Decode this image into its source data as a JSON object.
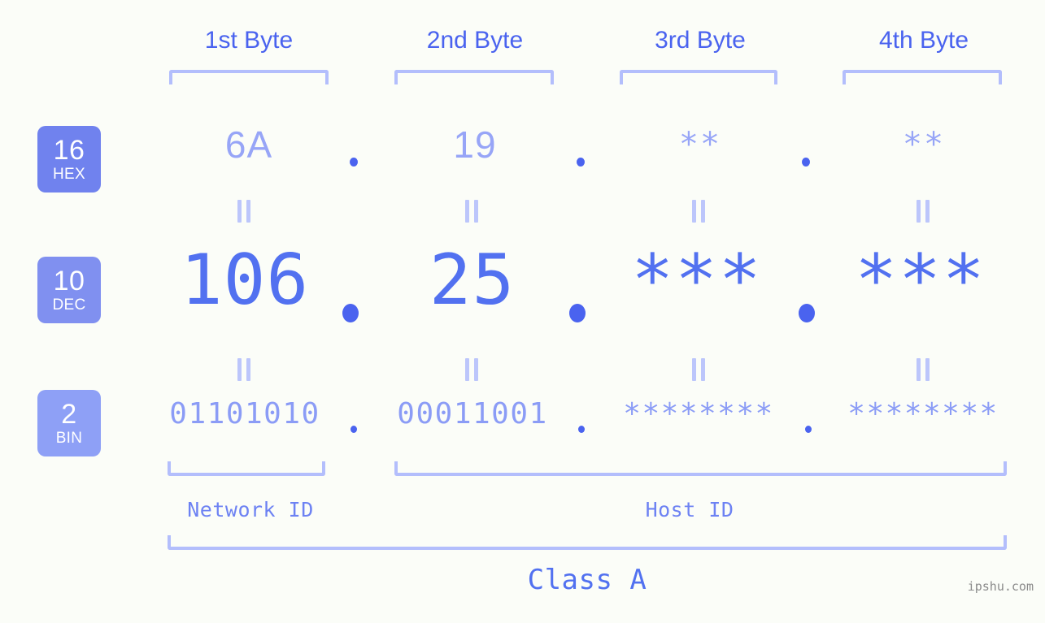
{
  "page": {
    "background": "#fbfdf8",
    "accent": "#5271f0",
    "accent_light": "#97a5f7",
    "bracket_color": "#b3befc",
    "watermark": "ipshu.com"
  },
  "byte_headers": [
    {
      "label": "1st Byte"
    },
    {
      "label": "2nd Byte"
    },
    {
      "label": "3rd Byte"
    },
    {
      "label": "4th Byte"
    }
  ],
  "bases": [
    {
      "number": "16",
      "name": "HEX",
      "color": "#7082ee"
    },
    {
      "number": "10",
      "name": "DEC",
      "color": "#8090f0"
    },
    {
      "number": "2",
      "name": "BIN",
      "color": "#8ea0f6"
    }
  ],
  "rows": {
    "hex": {
      "base_number": "16",
      "base_name": "HEX",
      "values": [
        "6A",
        "19",
        "**",
        "**"
      ],
      "separator": "."
    },
    "dec": {
      "base_number": "10",
      "base_name": "DEC",
      "values": [
        "106",
        "25",
        "***",
        "***"
      ],
      "separator": "."
    },
    "bin": {
      "base_number": "2",
      "base_name": "BIN",
      "values": [
        "01101010",
        "00011001",
        "********",
        "********"
      ],
      "separator": "."
    }
  },
  "equals_glyph": "||",
  "sections": {
    "network_id": "Network ID",
    "host_id": "Host ID",
    "class": "Class A"
  },
  "address": {
    "hex": "6A.19.**.**",
    "dec": "106.25.***.***",
    "bin": "01101010.00011001.********.********",
    "class": "Class A"
  }
}
